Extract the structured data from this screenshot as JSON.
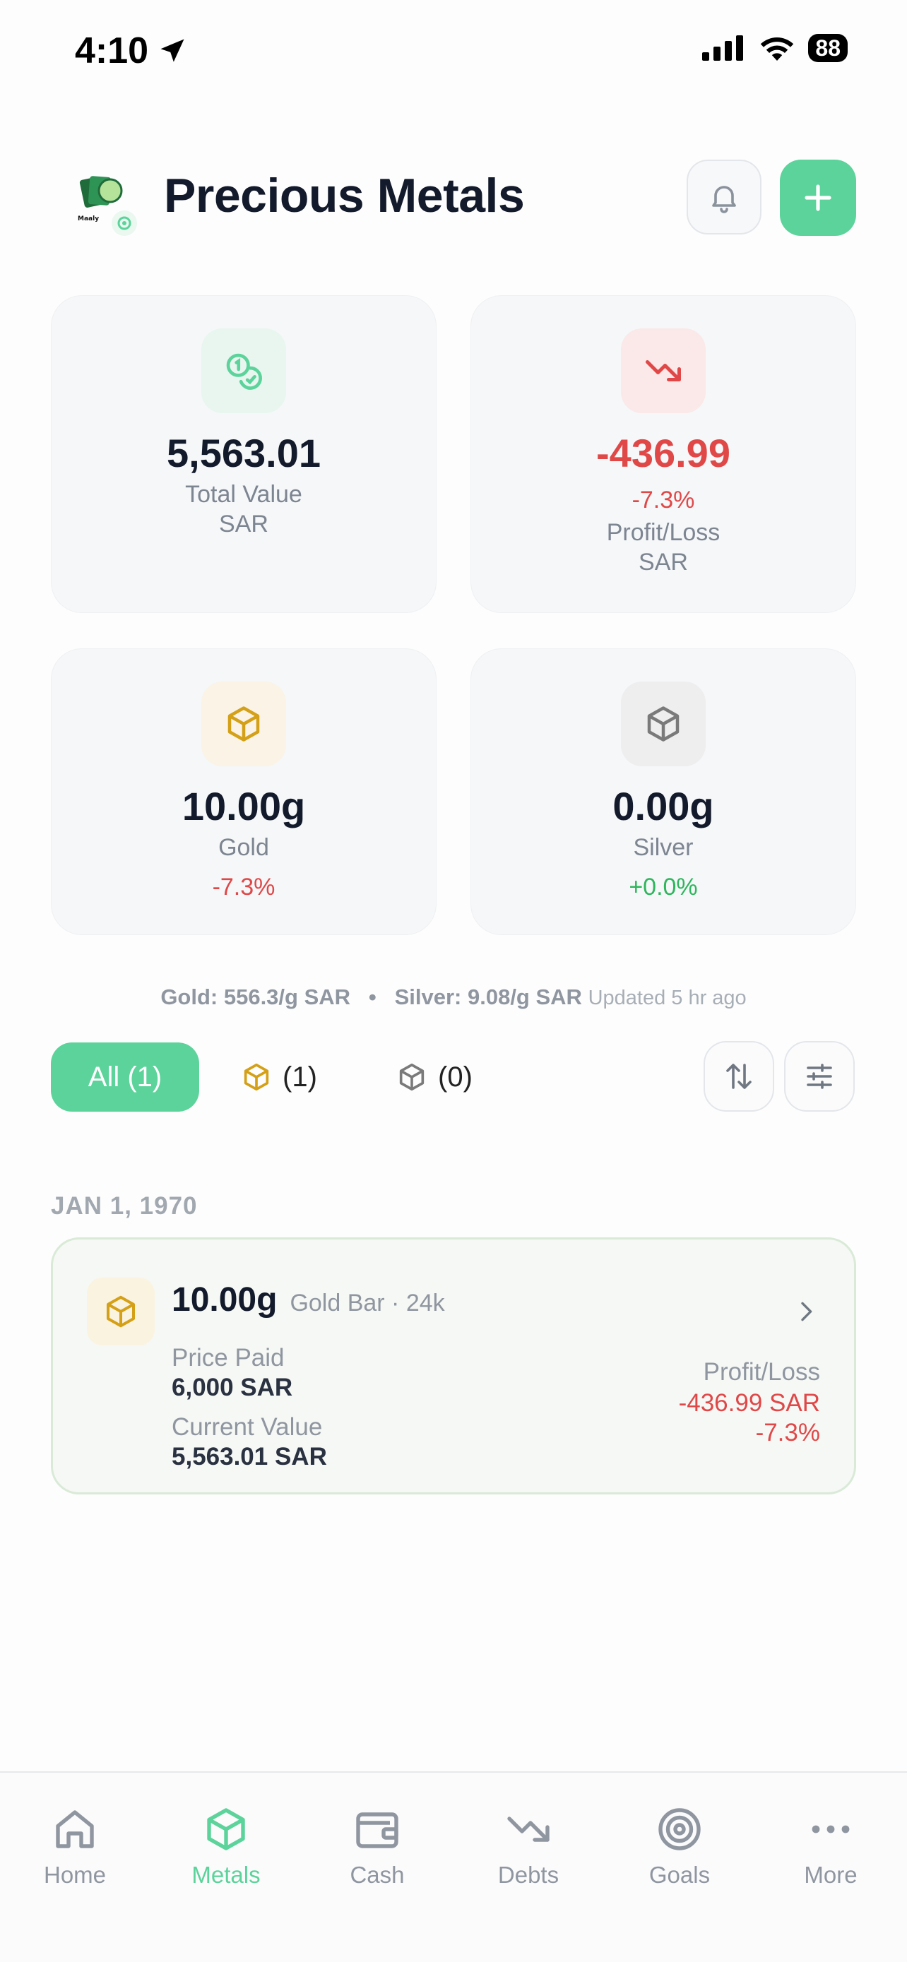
{
  "status": {
    "time": "4:10",
    "battery": "88"
  },
  "header": {
    "title": "Precious Metals",
    "logo_text": "Maaly"
  },
  "summary": {
    "total_value": "5,563.01",
    "total_value_label": "Total Value",
    "total_value_currency": "SAR",
    "profit_loss": "-436.99",
    "profit_loss_pct": "-7.3%",
    "profit_loss_label": "Profit/Loss",
    "profit_loss_currency": "SAR"
  },
  "metals": {
    "gold": {
      "weight": "10.00g",
      "label": "Gold",
      "change": "-7.3%"
    },
    "silver": {
      "weight": "0.00g",
      "label": "Silver",
      "change": "+0.0%"
    }
  },
  "prices": {
    "gold": "Gold: 556.3/g SAR",
    "separator": "•",
    "silver": "Silver: 9.08/g SAR",
    "updated": "Updated 5 hr ago"
  },
  "filters": {
    "all": "All (1)",
    "gold_count": "(1)",
    "silver_count": "(0)"
  },
  "holdings_group": {
    "date": "JAN 1, 1970",
    "items": [
      {
        "weight": "10.00g",
        "description": "Gold Bar · 24k",
        "price_paid_label": "Price Paid",
        "price_paid": "6,000 SAR",
        "current_value_label": "Current Value",
        "current_value": "5,563.01 SAR",
        "pl_label": "Profit/Loss",
        "pl_value": "-436.99 SAR",
        "pl_pct": "-7.3%"
      }
    ]
  },
  "nav": {
    "items": [
      {
        "label": "Home"
      },
      {
        "label": "Metals"
      },
      {
        "label": "Cash"
      },
      {
        "label": "Debts"
      },
      {
        "label": "Goals"
      },
      {
        "label": "More"
      }
    ],
    "active": "Metals"
  },
  "colors": {
    "accent": "#5cd39b",
    "negative": "#e04848",
    "positive": "#2fb65c",
    "gold": "#d4a017",
    "silver": "#7a7a7a"
  }
}
